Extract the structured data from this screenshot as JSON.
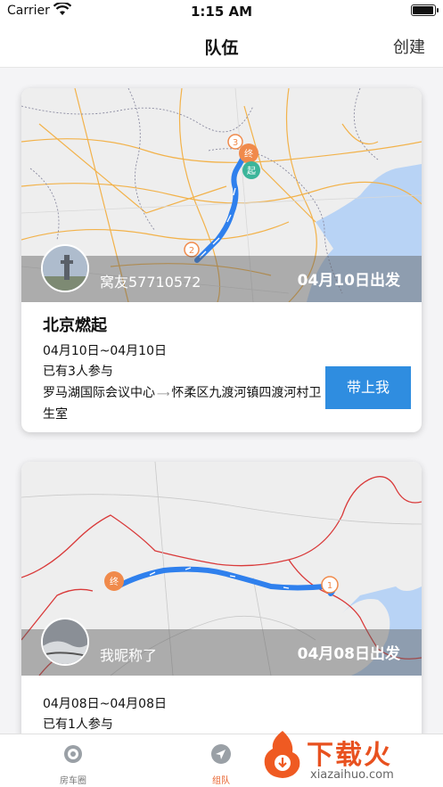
{
  "status_bar": {
    "carrier": "Carrier",
    "time": "1:15 AM"
  },
  "nav": {
    "title": "队伍",
    "create_label": "创建"
  },
  "teams": [
    {
      "owner": "窝友57710572",
      "depart": "04月10日出发",
      "title": "北京燃起",
      "date_range": "04月10日~04月10日",
      "participants": "已有3人参与",
      "route_from": "罗马湖国际会议中心",
      "route_to": "怀柔区九渡河镇四渡河村卫生室",
      "action_label": "带上我",
      "markers": [
        "3",
        "终",
        "起",
        "2"
      ]
    },
    {
      "owner": "我昵称了",
      "depart": "04月08日出发",
      "date_range": "04月08日~04月08日",
      "participants": "已有1人参与",
      "markers": [
        "终",
        "1"
      ]
    }
  ],
  "tabs": [
    {
      "label": "房车圈",
      "icon": "target-icon"
    },
    {
      "label": "组队",
      "icon": "navigation-arrow-icon"
    }
  ],
  "watermark": {
    "text": "下载火",
    "sub": "xiazaihuo.com"
  },
  "colors": {
    "accent_orange": "#e8622d",
    "button_blue": "#2f8de0",
    "route_blue": "#3a8fe6",
    "marker_orange": "#f08a4b",
    "marker_green": "#3bb59a"
  }
}
